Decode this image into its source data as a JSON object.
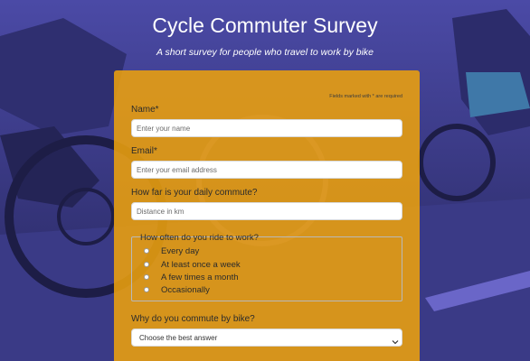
{
  "page": {
    "title": "Cycle Commuter Survey",
    "subtitle": "A short survey for people who travel to work by bike"
  },
  "form": {
    "required_note": "Fields marked with * are required",
    "name": {
      "label": "Name*",
      "placeholder": "Enter your name"
    },
    "email": {
      "label": "Email*",
      "placeholder": "Enter your email address"
    },
    "distance": {
      "label": "How far is your daily commute?",
      "placeholder": "Distance in km"
    },
    "frequency": {
      "legend": "How often do you ride to work?",
      "options": [
        "Every day",
        "At least once a week",
        "A few times a month",
        "Occasionally"
      ]
    },
    "reason": {
      "label": "Why do you commute by bike?",
      "selected": "Choose the best answer"
    }
  },
  "colors": {
    "panel": "#f0a30a",
    "overlay": "#3b3899",
    "title_text": "#ffffff"
  },
  "icons": {
    "select_arrow": "chevron-down-icon",
    "background": "cyclists-photo"
  }
}
